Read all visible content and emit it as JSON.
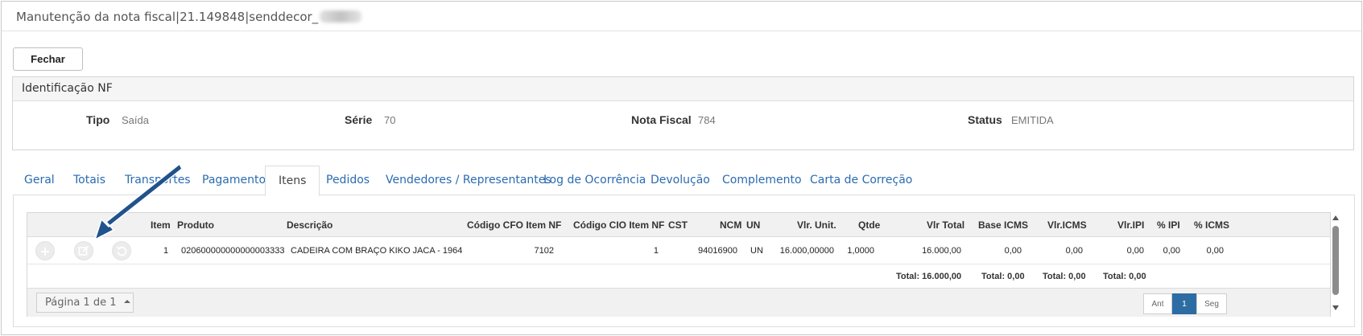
{
  "window": {
    "title": "Manutenção da nota fiscal|21.149848|senddecor_"
  },
  "toolbar": {
    "close_label": "Fechar"
  },
  "identificacao": {
    "heading": "Identificação NF",
    "tipo_label": "Tipo",
    "tipo_value": "Saída",
    "serie_label": "Série",
    "serie_value": "70",
    "nota_label": "Nota Fiscal",
    "nota_value": "784",
    "status_label": "Status",
    "status_value": "EMITIDA"
  },
  "tabs": [
    {
      "label": "Geral"
    },
    {
      "label": "Totais"
    },
    {
      "label": "Transportes"
    },
    {
      "label": "Pagamento"
    },
    {
      "label": "Itens",
      "active": true
    },
    {
      "label": "Pedidos"
    },
    {
      "label": "Vendedores / Representantes"
    },
    {
      "label": "Log de Ocorrência"
    },
    {
      "label": "Devolução"
    },
    {
      "label": "Complemento"
    },
    {
      "label": "Carta de Correção"
    }
  ],
  "grid": {
    "columns": [
      "Item",
      "Produto",
      "Descrição",
      "Código CFO Item NF",
      "Código CIO Item NF",
      "CST",
      "NCM",
      "UN",
      "Vlr. Unit.",
      "Qtde",
      "Vlr Total",
      "Base ICMS",
      "Vlr.ICMS",
      "Vlr.IPI",
      "% IPI",
      "% ICMS"
    ],
    "row_actions": [
      {
        "icon": "plus-icon"
      },
      {
        "icon": "edit-icon"
      },
      {
        "icon": "undo-icon"
      }
    ],
    "rows": [
      {
        "item": "1",
        "produto": "020600000000000003333",
        "descricao": "CADEIRA COM BRAÇO KIKO JACA - 1964",
        "cfo": "7102",
        "cio": "1",
        "cst": "",
        "ncm": "94016900",
        "un": "UN",
        "vlr_unit": "16.000,00000",
        "qtde": "1,0000",
        "vlr_total": "16.000,00",
        "base_icms": "0,00",
        "vlr_icms": "0,00",
        "vlr_ipi": "0,00",
        "pct_ipi": "0,00",
        "pct_icms": "0,00"
      }
    ],
    "totals": {
      "vlr_total": "Total: 16.000,00",
      "base_icms": "Total: 0,00",
      "vlr_icms": "Total: 0,00",
      "vlr_ipi": "Total: 0,00"
    },
    "pager": {
      "label": "Página 1 de 1",
      "prev_label": "Ant",
      "current_page": "1",
      "next_label": "Seg"
    }
  },
  "colors": {
    "link": "#2a6bb1",
    "active_page": "#2d6da3",
    "annotation_arrow": "#1f4e86"
  }
}
